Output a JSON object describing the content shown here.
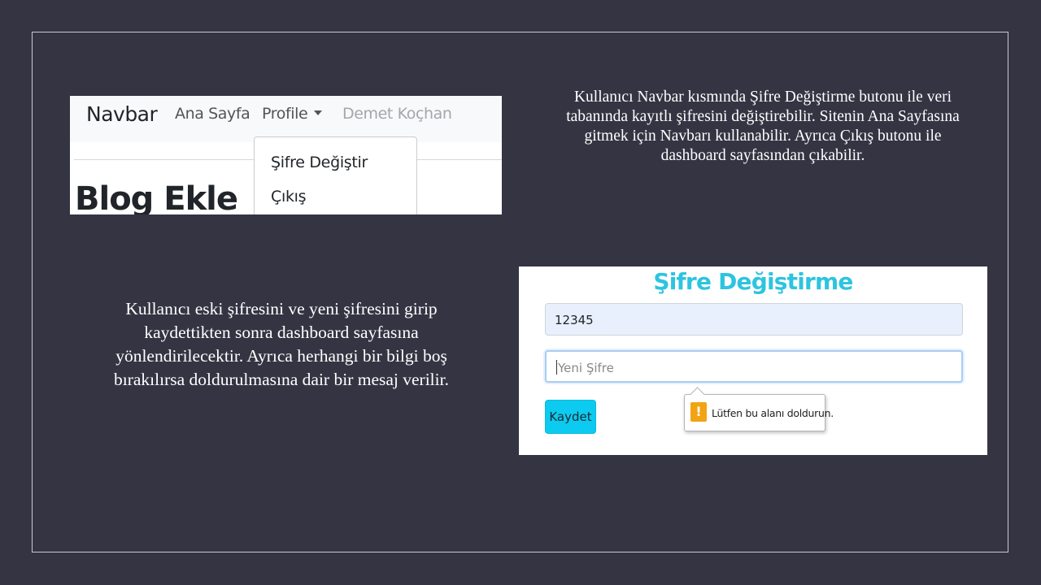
{
  "navbar_screenshot": {
    "brand": "Navbar",
    "links": [
      "Ana Sayfa",
      "Profile"
    ],
    "user_name": "Demet Koçhan",
    "dropdown_items": [
      "Şifre Değiştir",
      "Çıkış"
    ],
    "page_heading": "Blog Ekle"
  },
  "captions": {
    "top_right": "Kullanıcı Navbar kısmında Şifre Değiştirme butonu ile veri tabanında kayıtlı şifresini değiştirebilir. Sitenin Ana Sayfasına gitmek için Navbarı kullanabilir. Ayrıca Çıkış butonu ile dashboard sayfasından çıkabilir.",
    "middle_left": "Kullanıcı eski şifresini ve yeni şifresini girip kaydettikten sonra dashboard sayfasına yönlendirilecektir. Ayrıca herhangi bir bilgi boş bırakılırsa doldurulmasına dair bir mesaj verilir."
  },
  "password_screenshot": {
    "title": "Şifre Değiştirme",
    "old_password_value": "12345",
    "new_password_placeholder": "Yeni Şifre",
    "save_button": "Kaydet",
    "validation_message": "Lütfen bu alanı doldurun.",
    "warning_icon": "exclamation-warning-icon"
  },
  "colors": {
    "slide_background": "#353443",
    "title_accent": "#2dc4df",
    "button_bg": "#0dcaf0",
    "warning": "#f2a314"
  }
}
